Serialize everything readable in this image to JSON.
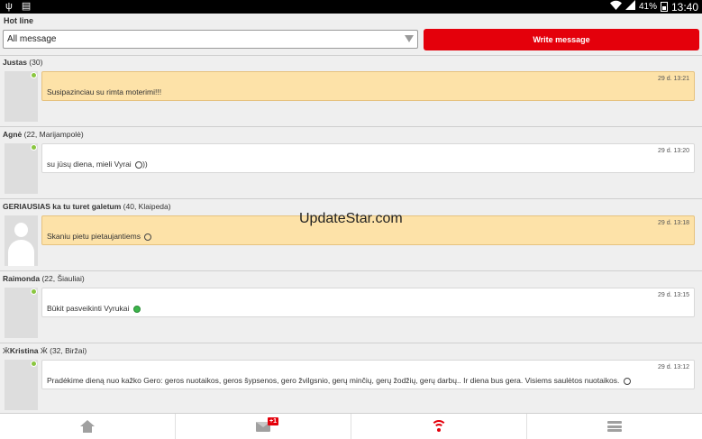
{
  "status_bar": {
    "battery": "41%",
    "time": "13:40",
    "left_icons": [
      "usb-icon",
      "notification-icon"
    ],
    "right_icons": [
      "wifi-icon",
      "signal-icon",
      "battery-icon"
    ]
  },
  "header": {
    "title": "Hot line",
    "filter_value": "All message",
    "write_button": "Write message"
  },
  "messages": [
    {
      "name": "Justas",
      "meta": " (30)",
      "time": "29 d. 13:21",
      "text": "Susipazinciau su rimta moterimi!!!",
      "highlighted": true,
      "online": true,
      "avatar": "photo"
    },
    {
      "name": "Agnė",
      "meta": " (22, Marijampolė)",
      "time": "29 d. 13:20",
      "text": "su jūsų diena, mieli Vyrai",
      "suffix": "))",
      "highlighted": false,
      "online": true,
      "avatar": "photo"
    },
    {
      "name": "GERIAUSIAS ka tu turet galetum",
      "meta": " (40, Klaipeda)",
      "time": "29 d. 13:18",
      "text": "Skaniu pietu pietaujantiems",
      "highlighted": true,
      "online": false,
      "avatar": "placeholder"
    },
    {
      "name": "Raimonda",
      "meta": " (22, Šiauliai)",
      "time": "29 d. 13:15",
      "text": "Būkit pasveikinti Vyrukai",
      "highlighted": false,
      "online": true,
      "avatar": "photo"
    },
    {
      "name": "Kristina",
      "prefix": "Ӝ",
      "suffix_name": "Ӝ",
      "meta": " (32, Biržai)",
      "time": "29 d. 13:12",
      "text": "Pradėkime dieną nuo kažko Gero: geros nuotaikos, geros šypsenos, gero žvilgsnio, gerų minčių, gerų žodžių, gerų darbų.. Ir diena bus gera. Visiems saulėtos nuotaikos.",
      "highlighted": false,
      "online": true,
      "avatar": "photo"
    }
  ],
  "watermark": "UpdateStar.com",
  "bottom_nav": {
    "items": [
      "home-icon",
      "mail-icon",
      "wifi-icon",
      "menu-icon"
    ],
    "mail_badge": "+1",
    "active": "wifi-icon"
  },
  "colors": {
    "accent": "#e4000b",
    "highlight_bg": "#fde2a8",
    "online": "#8ac640"
  }
}
